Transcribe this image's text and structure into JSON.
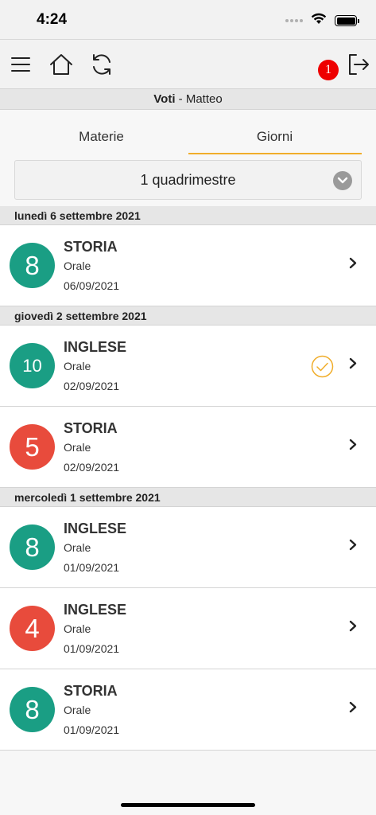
{
  "status": {
    "time": "4:24"
  },
  "toolbar": {
    "notification_count": "1"
  },
  "header": {
    "title": "Voti",
    "separator": " - ",
    "student": "Matteo"
  },
  "tabs": [
    {
      "label": "Materie",
      "active": false
    },
    {
      "label": "Giorni",
      "active": true
    }
  ],
  "period": {
    "selected": "1 quadrimestre"
  },
  "colors": {
    "green": "#1a9e84",
    "red": "#e84b3c",
    "accent": "#f0ad2a"
  },
  "days": [
    {
      "label": "lunedì 6 settembre 2021",
      "grades": [
        {
          "grade": "8",
          "subject": "STORIA",
          "type": "Orale",
          "date": "06/09/2021",
          "color": "green",
          "checked": false
        }
      ]
    },
    {
      "label": "giovedì 2 settembre 2021",
      "grades": [
        {
          "grade": "10",
          "subject": "INGLESE",
          "type": "Orale",
          "date": "02/09/2021",
          "color": "green",
          "checked": true
        },
        {
          "grade": "5",
          "subject": "STORIA",
          "type": "Orale",
          "date": "02/09/2021",
          "color": "red",
          "checked": false
        }
      ]
    },
    {
      "label": "mercoledì 1 settembre 2021",
      "grades": [
        {
          "grade": "8",
          "subject": "INGLESE",
          "type": "Orale",
          "date": "01/09/2021",
          "color": "green",
          "checked": false
        },
        {
          "grade": "4",
          "subject": "INGLESE",
          "type": "Orale",
          "date": "01/09/2021",
          "color": "red",
          "checked": false
        },
        {
          "grade": "8",
          "subject": "STORIA",
          "type": "Orale",
          "date": "01/09/2021",
          "color": "green",
          "checked": false
        }
      ]
    }
  ]
}
